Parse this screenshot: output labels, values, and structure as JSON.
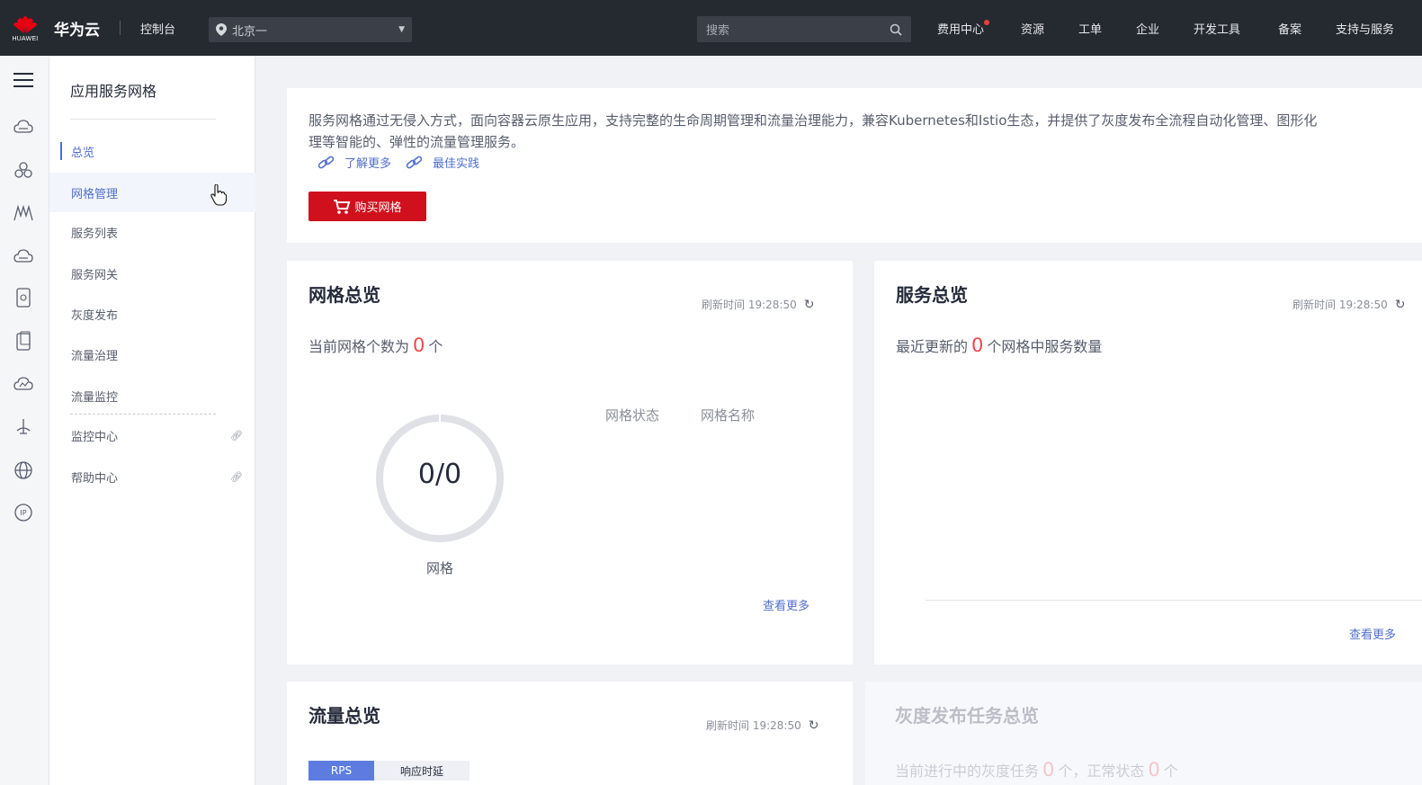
{
  "topbar": {
    "logo_word": "HUAWEI",
    "brand": "华为云",
    "console": "控制台",
    "region": "北京一",
    "search_placeholder": "搜索",
    "nav": [
      "费用中心",
      "资源",
      "工单",
      "企业",
      "开发工具",
      "备案",
      "支持与服务"
    ]
  },
  "rail_icons": [
    "menu-icon",
    "cloud-server-icon",
    "container-icon",
    "microservice-icon",
    "cloud-icon",
    "storage-icon",
    "database-icon",
    "cloud-network-icon",
    "deploy-icon",
    "globe-icon",
    "ip-icon"
  ],
  "sidebar": {
    "title": "应用服务网格",
    "items": [
      {
        "label": "总览",
        "state": "active"
      },
      {
        "label": "网格管理",
        "state": "hover"
      },
      {
        "label": "服务列表",
        "state": ""
      },
      {
        "label": "服务网关",
        "state": ""
      },
      {
        "label": "灰度发布",
        "state": ""
      },
      {
        "label": "流量治理",
        "state": ""
      },
      {
        "label": "流量监控",
        "state": ""
      }
    ],
    "external": [
      {
        "label": "监控中心"
      },
      {
        "label": "帮助中心"
      }
    ]
  },
  "intro": {
    "line1": "服务网格通过无侵入方式，面向容器云原生应用，支持完整的生命周期管理和流量治理能力，兼容Kubernetes和Istio生态，并提供了灰度发布全流程自动化管理、图形化",
    "line2": "理等智能的、弹性的流量管理服务。",
    "link_learn": "了解更多",
    "link_best": "最佳实践",
    "buy_button": "购买网格"
  },
  "mesh_overview": {
    "title": "网格总览",
    "refresh_time": "刷新时间 19:28:50",
    "count_prefix": "当前网格个数为",
    "count": "0",
    "count_suffix": "个",
    "donut_value": "0/0",
    "donut_fraction": 0,
    "donut_label": "网格",
    "col_status": "网格状态",
    "col_name": "网格名称",
    "more": "查看更多"
  },
  "service_overview": {
    "title": "服务总览",
    "refresh_time": "刷新时间 19:28:50",
    "text_prefix": "最近更新的",
    "count": "0",
    "text_suffix": "个网格中服务数量",
    "more": "查看更多"
  },
  "traffic_overview": {
    "title": "流量总览",
    "refresh_time": "刷新时间 19:28:50",
    "tab_rps": "RPS",
    "tab_latency": "响应时延"
  },
  "gray_overview": {
    "title": "灰度发布任务总览",
    "text_prefix": "当前进行中的灰度任务",
    "running": "0",
    "text_mid": "个，正常状态",
    "normal": "0",
    "text_suffix": "个"
  },
  "colors": {
    "topbar": "#252a30",
    "accent": "#526ecc",
    "buy": "#d1101e",
    "number": "#f0454b"
  }
}
